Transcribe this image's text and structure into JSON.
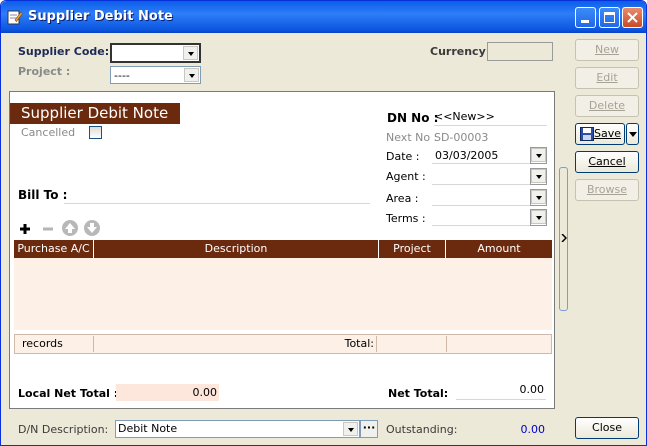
{
  "window": {
    "title": "Supplier Debit Note"
  },
  "header": {
    "supplier_code_label": "Supplier Code:",
    "supplier_code_value": "",
    "project_label": "Project :",
    "project_value": "----",
    "currency_label": "Currency:",
    "currency_value": ""
  },
  "sidebar_buttons": {
    "new": "New",
    "edit": "Edit",
    "delete": "Delete",
    "save": "Save",
    "cancel": "Cancel",
    "browse": "Browse",
    "close": "Close"
  },
  "form": {
    "heading": "Supplier Debit Note",
    "cancelled_label": "Cancelled",
    "cancelled_checked": false,
    "dn_no_label": "DN No :",
    "dn_no_value": "<<New>>",
    "next_no_label": "Next No :",
    "next_no_value": "SD-00003",
    "date_label": "Date :",
    "date_value": "03/03/2005",
    "agent_label": "Agent :",
    "agent_value": "",
    "area_label": "Area :",
    "area_value": "",
    "terms_label": "Terms :",
    "terms_value": "",
    "bill_to_label": "Bill To :",
    "bill_to_value": ""
  },
  "grid": {
    "columns": [
      "Purchase  A/C",
      "Description",
      "Project",
      "Amount"
    ],
    "records_label": "records",
    "total_label": "Total:",
    "total_value": ""
  },
  "totals": {
    "local_net_total_label": "Local Net Total :",
    "local_net_total_value": "0.00",
    "net_total_label": "Net Total:",
    "net_total_value": "0.00"
  },
  "bottom": {
    "dn_description_label": "D/N Description:",
    "dn_description_value": "Debit Note",
    "ellipsis_label": "···",
    "outstanding_label": "Outstanding:",
    "outstanding_value": "0.00"
  },
  "colors": {
    "titlebar": "#0a5ee9",
    "grid_header": "#6b2a0e",
    "heading_bg": "#6b2a0e",
    "outstanding": "#0000cc"
  }
}
